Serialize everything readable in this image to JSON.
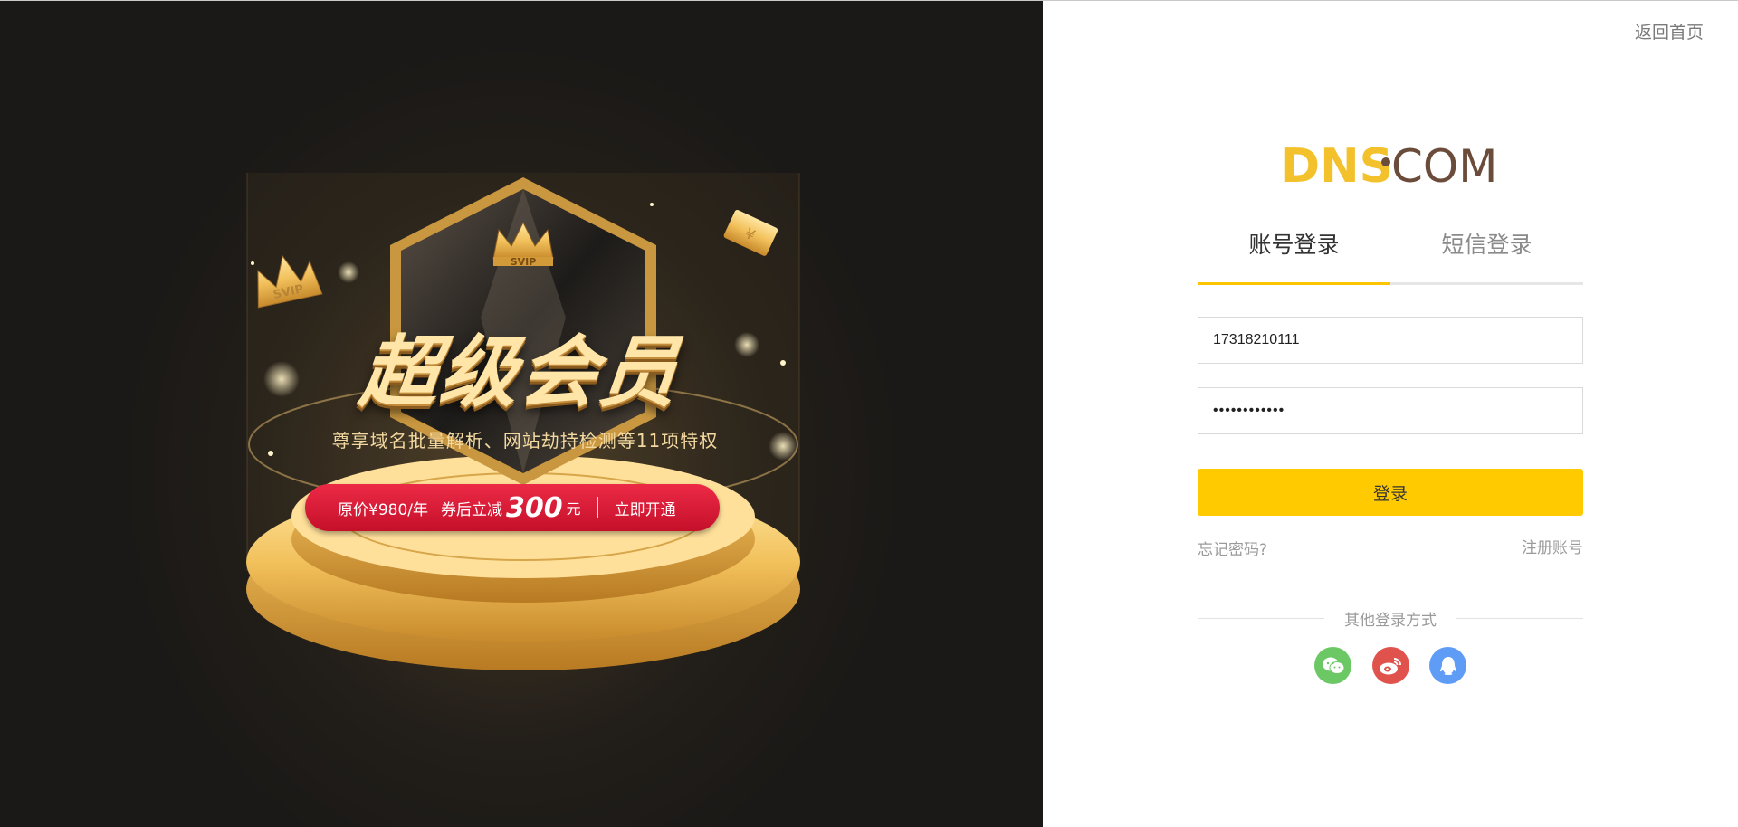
{
  "promo": {
    "crown_badge": "SVIP",
    "title": "超级会员",
    "subtitle": "尊享域名批量解析、网站劫持检测等11项特权",
    "cta_price": "原价¥980/年",
    "cta_coupon": "券后立减",
    "cta_amount": "300",
    "cta_unit": "元",
    "cta_open": "立即开通",
    "ticket_symbol": "¥"
  },
  "login": {
    "home_link": "返回首页",
    "logo_brand": "DNS",
    "logo_suffix": "COM",
    "tabs": [
      {
        "label": "账号登录",
        "active": true
      },
      {
        "label": "短信登录",
        "active": false
      }
    ],
    "phone_value": "17318210111",
    "password_value": "••••••••••••",
    "submit_label": "登录",
    "forgot_label": "忘记密码?",
    "register_label": "注册账号",
    "other_login_label": "其他登录方式",
    "social": [
      {
        "name": "wechat-icon",
        "color": "#6cc864"
      },
      {
        "name": "weibo-icon",
        "color": "#e0534d"
      },
      {
        "name": "qq-icon",
        "color": "#5e9cf5"
      }
    ]
  },
  "colors": {
    "accent": "#ffcb00",
    "tab_underline": "#ffc400",
    "cta_red": "#d81a35"
  }
}
